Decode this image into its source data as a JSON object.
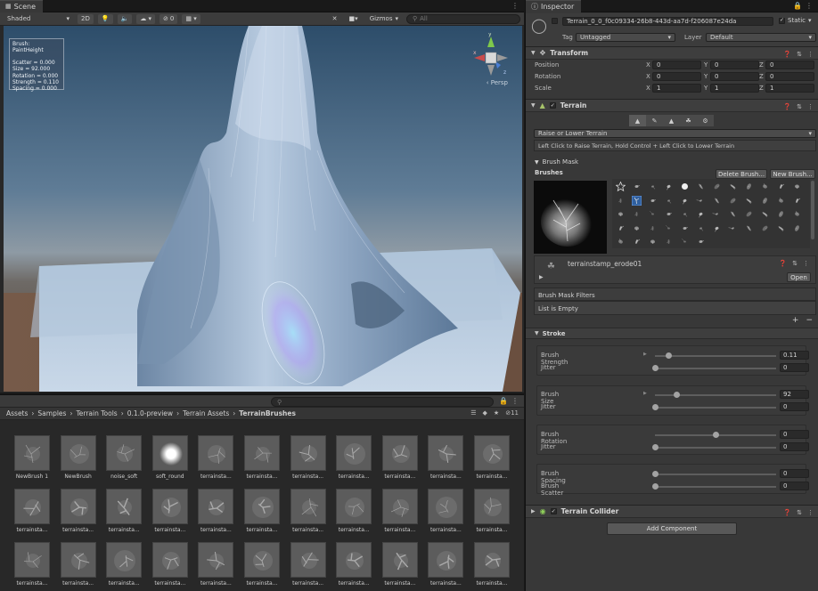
{
  "scene": {
    "tab_label": "Scene",
    "shading_mode": "Shaded",
    "toggle_2d": "2D",
    "hidden_count": "0",
    "gizmos_label": "Gizmos",
    "search_placeholder": "All",
    "persp_label": "‹ Persp",
    "overlay": {
      "brush": "Brush: PaintHeight",
      "scatter": "Scatter = 0.000",
      "size": "Size = 92.000",
      "rotation": "Rotation = 0.000",
      "strength": "Strength = 0.110",
      "spacing": "Spacing = 0.000"
    },
    "gizmo_axes": {
      "y": "y",
      "x": "x",
      "z": "z"
    }
  },
  "project": {
    "breadcrumb": [
      "Assets",
      "Samples",
      "Terrain Tools",
      "0.1.0-preview",
      "Terrain Assets",
      "TerrainBrushes"
    ],
    "hidden_count": "11",
    "assets": [
      "NewBrush 1",
      "NewBrush",
      "noise_soft",
      "soft_round",
      "terrainsta...",
      "terrainsta...",
      "terrainsta...",
      "terrainsta...",
      "terrainsta...",
      "terrainsta...",
      "terrainsta...",
      "terrainsta...",
      "terrainsta...",
      "terrainsta...",
      "terrainsta...",
      "terrainsta...",
      "terrainsta...",
      "terrainsta...",
      "terrainsta...",
      "terrainsta...",
      "terrainsta...",
      "terrainsta...",
      "terrainsta...",
      "terrainsta...",
      "terrainsta...",
      "terrainsta...",
      "terrainsta...",
      "terrainsta...",
      "terrainsta...",
      "terrainsta...",
      "terrainsta...",
      "terrainsta...",
      "terrainsta..."
    ]
  },
  "inspector": {
    "tab_label": "Inspector",
    "object_name": "Terrain_0_0_f0c09334-26b8-443d-aa7d-f206087e24da",
    "static_label": "Static",
    "tag_label": "Tag",
    "tag_value": "Untagged",
    "layer_label": "Layer",
    "layer_value": "Default",
    "transform": {
      "title": "Transform",
      "rows": [
        {
          "label": "Position",
          "x": "0",
          "y": "0",
          "z": "0"
        },
        {
          "label": "Rotation",
          "x": "0",
          "y": "0",
          "z": "0"
        },
        {
          "label": "Scale",
          "x": "1",
          "y": "1",
          "z": "1"
        }
      ],
      "axis_x": "X",
      "axis_y": "Y",
      "axis_z": "Z"
    },
    "terrain": {
      "title": "Terrain",
      "tool_dropdown": "Raise or Lower Terrain",
      "help_text": "Left Click to Raise Terrain, Hold Control + Left Click to Lower Terrain",
      "brush_mask_label": "Brush Mask",
      "brushes_label": "Brushes",
      "delete_brush": "Delete Brush...",
      "new_brush": "New Brush...",
      "selected_brush": "terrainstamp_erode01",
      "open_button": "Open",
      "mask_filters_label": "Brush Mask Filters",
      "list_empty": "List is Empty",
      "stroke_label": "Stroke",
      "brush_strength_label": "Brush Strength",
      "brush_strength": "0.11",
      "strength_jitter_label": "Jitter",
      "strength_jitter": "0",
      "brush_size_label": "Brush Size",
      "brush_size": "92",
      "size_jitter_label": "Jitter",
      "size_jitter": "0",
      "brush_rotation_label": "Brush Rotation",
      "brush_rotation": "0",
      "rotation_jitter_label": "Jitter",
      "rotation_jitter": "0",
      "brush_spacing_label": "Brush Spacing",
      "brush_spacing": "0",
      "brush_scatter_label": "Brush Scatter",
      "brush_scatter": "0"
    },
    "collider": {
      "title": "Terrain Collider"
    },
    "add_component": "Add Component"
  },
  "colors": {
    "sky_top": "#2b4a66",
    "ground": "#6f5444",
    "terrain": "#c8d6e8",
    "selection": "#3f6fb8"
  }
}
